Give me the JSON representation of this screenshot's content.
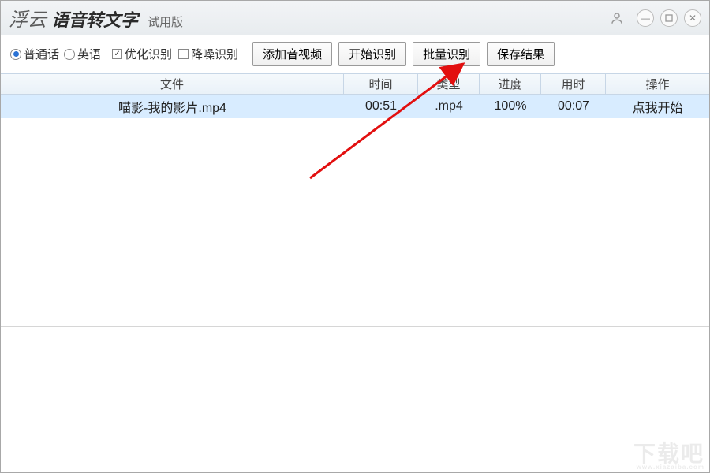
{
  "title": {
    "brand_script": "浮云",
    "app_name": "语音转文字",
    "edition": "试用版"
  },
  "toolbar": {
    "lang_mandarin": "普通话",
    "lang_english": "英语",
    "opt_optimize": "优化识别",
    "opt_denoise": "降噪识别",
    "btn_add": "添加音视频",
    "btn_start": "开始识别",
    "btn_batch": "批量识别",
    "btn_save": "保存结果"
  },
  "table": {
    "headers": {
      "file": "文件",
      "time": "时间",
      "type": "类型",
      "progress": "进度",
      "elapsed": "用时",
      "action": "操作"
    },
    "rows": [
      {
        "file": "喵影-我的影片.mp4",
        "time": "00:51",
        "type": ".mp4",
        "progress": "100%",
        "elapsed": "00:07",
        "action": "点我开始"
      }
    ]
  },
  "watermark": {
    "big": "下载吧",
    "small": "www.xiazaiba.com"
  }
}
